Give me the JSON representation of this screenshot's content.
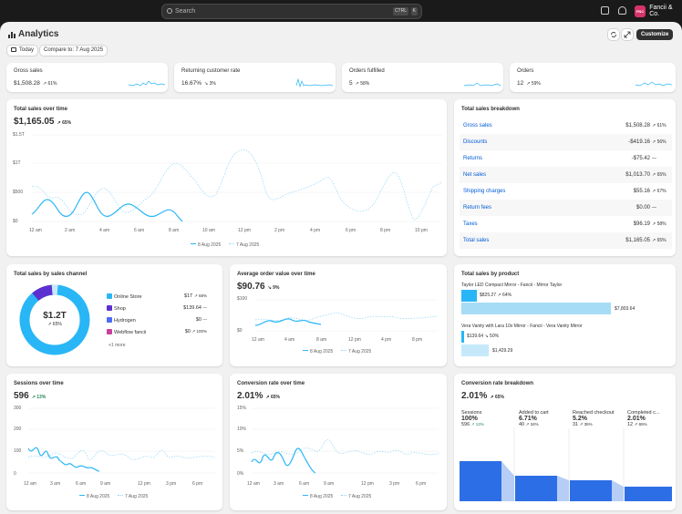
{
  "topbar": {
    "search_placeholder": "Search",
    "kbd_ctrl": "CTRL",
    "kbd_k": "K",
    "store_badge": "FNC",
    "store_name": "Fancii & Co."
  },
  "page": {
    "title": "Analytics",
    "date_btn": "Today",
    "compare_btn": "Compare to: 7 Aug 2025",
    "customize": "Customize"
  },
  "kpis": [
    {
      "title": "Gross sales",
      "value": "$1,508.28",
      "delta": "↗ 61%"
    },
    {
      "title": "Returning customer rate",
      "value": "16.67%",
      "delta": "↘ 3%"
    },
    {
      "title": "Orders fulfilled",
      "value": "5",
      "delta": "↗ 58%"
    },
    {
      "title": "Orders",
      "value": "12",
      "delta": "↗ 59%"
    }
  ],
  "total_sales": {
    "title": "Total sales over time",
    "value": "$1,165.05",
    "delta": "↗ 65%",
    "yticks": [
      "$1.5T",
      "$1T",
      "$500",
      "$0"
    ],
    "xticks": [
      "12 am",
      "2 am",
      "4 am",
      "6 am",
      "8 am",
      "10 am",
      "12 pm",
      "2 pm",
      "4 pm",
      "6 pm",
      "8 pm",
      "10 pm"
    ],
    "legend_cur": "8 Aug 2025",
    "legend_prev": "7 Aug 2025"
  },
  "breakdown": {
    "title": "Total sales breakdown",
    "rows": [
      {
        "label": "Gross sales",
        "value": "$1,508.28",
        "delta": "↗ 61%"
      },
      {
        "label": "Discounts",
        "value": "-$419.16",
        "delta": "↗ 56%"
      },
      {
        "label": "Returns",
        "value": "-$75.42",
        "delta": "—"
      },
      {
        "label": "Net sales",
        "value": "$1,013.70",
        "delta": "↗ 65%"
      },
      {
        "label": "Shipping charges",
        "value": "$55.16",
        "delta": "↗ 67%"
      },
      {
        "label": "Return fees",
        "value": "$0.00",
        "delta": "—"
      },
      {
        "label": "Taxes",
        "value": "$96.19",
        "delta": "↗ 58%"
      },
      {
        "label": "Total sales",
        "value": "$1,165.05",
        "delta": "↗ 65%"
      }
    ]
  },
  "channel": {
    "title": "Total sales by sales channel",
    "center_value": "$1.2T",
    "center_delta": "↗ 65%",
    "items": [
      {
        "name": "Online Store",
        "value": "$1T",
        "delta": "↗ 68%",
        "color": "#29b6f6"
      },
      {
        "name": "Shop",
        "value": "$139.64",
        "delta": "—",
        "color": "#5c2fd0"
      },
      {
        "name": "Hydrogen",
        "value": "$0",
        "delta": "—",
        "color": "#4a6cf7"
      },
      {
        "name": "Webflow fancii",
        "value": "$0",
        "delta": "↗ 100%",
        "color": "#c8409c"
      }
    ],
    "more": "+1 more"
  },
  "aov": {
    "title": "Average order value over time",
    "value": "$90.76",
    "delta": "↘ 9%",
    "yticks": [
      "$100",
      "$0"
    ],
    "xticks": [
      "12 am",
      "4 am",
      "8 am",
      "12 pm",
      "4 pm",
      "8 pm"
    ],
    "legend_cur": "8 Aug 2025",
    "legend_prev": "7 Aug 2025"
  },
  "product": {
    "title": "Total sales by product",
    "items": [
      {
        "name": "Taylor LED Compact Mirror - Fancii - Mirror Taylor",
        "cur": "$825.27",
        "delta": "↗ 64%",
        "prev": "$7,803.64",
        "cur_frac": 0.1,
        "prev_frac": 1.0
      },
      {
        "name": "Vera Vanity with Lara 10x Mirror - Fancii - Vera Vanity Mirror",
        "cur": "$139.64",
        "delta": "↘ 50%",
        "prev": "$1,429.29",
        "cur_frac": 0.02,
        "prev_frac": 0.18
      }
    ]
  },
  "sessions": {
    "title": "Sessions over time",
    "value": "596",
    "delta": "↗ 13%",
    "yticks": [
      "300",
      "200",
      "100",
      "0"
    ],
    "xticks": [
      "12 am",
      "3 am",
      "6 am",
      "9 am",
      "12 pm",
      "3 pm",
      "6 pm"
    ],
    "legend_cur": "8 Aug 2025",
    "legend_prev": "7 Aug 2025"
  },
  "conversion": {
    "title": "Conversion rate over time",
    "value": "2.01%",
    "delta": "↗ 65%",
    "yticks": [
      "15%",
      "10%",
      "5%",
      "0%"
    ],
    "xticks": [
      "12 am",
      "3 am",
      "6 am",
      "9 am",
      "12 pm",
      "3 pm",
      "6 pm"
    ],
    "legend_cur": "8 Aug 2025",
    "legend_prev": "7 Aug 2025"
  },
  "funnel": {
    "title": "Conversion rate breakdown",
    "value": "2.01%",
    "delta": "↗ 65%",
    "stages": [
      {
        "label": "Sessions",
        "value": "100%",
        "sub": "596",
        "sub_delta": "↗ 13%",
        "frac": 1.0
      },
      {
        "label": "Added to cart",
        "value": "6.71%",
        "sub": "40",
        "sub_delta": "↗ 34%",
        "frac": 0.38
      },
      {
        "label": "Reached checkout",
        "value": "5.2%",
        "sub": "31",
        "sub_delta": "↗ 35%",
        "frac": 0.3
      },
      {
        "label": "Completed c...",
        "value": "2.01%",
        "sub": "12",
        "sub_delta": "↗ 65%",
        "frac": 0.18
      }
    ]
  }
}
